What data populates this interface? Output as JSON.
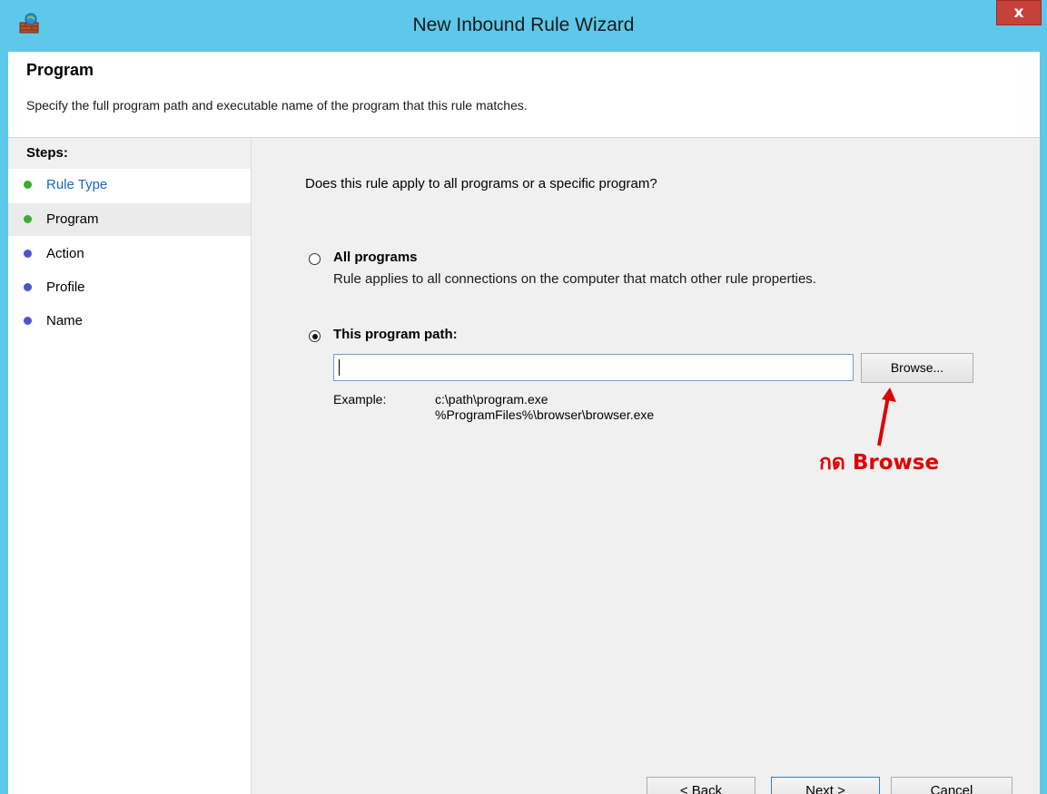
{
  "window": {
    "title": "New Inbound Rule Wizard",
    "close_label": "x"
  },
  "header": {
    "title": "Program",
    "description": "Specify the full program path and executable name of the program that this rule matches."
  },
  "steps": {
    "heading": "Steps:",
    "items": [
      {
        "label": "Rule Type",
        "state": "done",
        "dot_color": "#3dab34"
      },
      {
        "label": "Program",
        "state": "current",
        "dot_color": "#3dab34"
      },
      {
        "label": "Action",
        "state": "pending",
        "dot_color": "#4a56c9"
      },
      {
        "label": "Profile",
        "state": "pending",
        "dot_color": "#4a56c9"
      },
      {
        "label": "Name",
        "state": "pending",
        "dot_color": "#4a56c9"
      }
    ]
  },
  "main": {
    "question": "Does this rule apply to all programs or a specific program?",
    "all_programs": {
      "label": "All programs",
      "description": "Rule applies to all connections on the computer that match other rule properties.",
      "selected": false
    },
    "program_path": {
      "label": "This program path:",
      "selected": true,
      "value": ""
    },
    "browse_label": "Browse...",
    "example_label": "Example:",
    "example_lines": [
      "c:\\path\\program.exe",
      "%ProgramFiles%\\browser\\browser.exe"
    ]
  },
  "annotation": {
    "text": "กด Browse",
    "color": "#e10000"
  },
  "footer": {
    "back_label": "< Back",
    "next_label": "Next >",
    "cancel_label": "Cancel"
  },
  "icons": {
    "app": "firewall-icon",
    "close": "close-icon"
  }
}
